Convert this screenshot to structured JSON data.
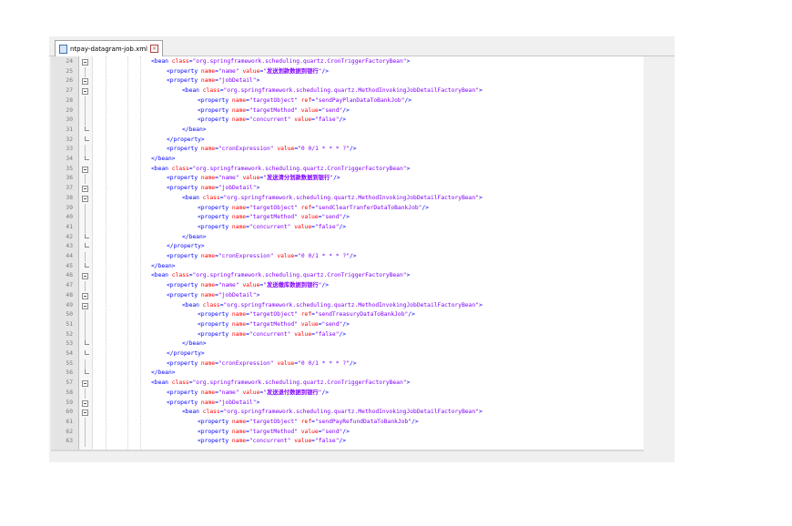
{
  "tab": {
    "label": "ntpay-datagram-job.xml",
    "close": "×"
  },
  "lines": [
    {
      "n": "24",
      "indent": 0,
      "fold": "box",
      "parts": [
        [
          "t",
          "<bean "
        ],
        [
          "a",
          "class"
        ],
        [
          "t",
          "="
        ],
        [
          "v",
          "\"org.springframework.scheduling.quartz.CronTriggerFactoryBean\""
        ],
        [
          "t",
          ">"
        ]
      ]
    },
    {
      "n": "25",
      "indent": 1,
      "fold": "vl",
      "parts": [
        [
          "t",
          "<property "
        ],
        [
          "a",
          "name"
        ],
        [
          "t",
          "="
        ],
        [
          "v",
          "\"name\" "
        ],
        [
          "a",
          "value"
        ],
        [
          "t",
          "="
        ],
        [
          "v",
          "\""
        ],
        [
          "cn",
          "发送划款数据到银行"
        ],
        [
          "v",
          "\""
        ],
        [
          "t",
          "/>"
        ]
      ]
    },
    {
      "n": "26",
      "indent": 1,
      "fold": "box",
      "parts": [
        [
          "t",
          "<property "
        ],
        [
          "a",
          "name"
        ],
        [
          "t",
          "="
        ],
        [
          "v",
          "\"jobDetail\""
        ],
        [
          "t",
          ">"
        ]
      ]
    },
    {
      "n": "27",
      "indent": 2,
      "fold": "box",
      "parts": [
        [
          "t",
          "<bean "
        ],
        [
          "a",
          "class"
        ],
        [
          "t",
          "="
        ],
        [
          "v",
          "\"org.springframework.scheduling.quartz.MethodInvokingJobDetailFactoryBean\""
        ],
        [
          "t",
          ">"
        ]
      ]
    },
    {
      "n": "28",
      "indent": 3,
      "fold": "vl",
      "parts": [
        [
          "t",
          "<property "
        ],
        [
          "a",
          "name"
        ],
        [
          "t",
          "="
        ],
        [
          "v",
          "\"targetObject\" "
        ],
        [
          "a",
          "ref"
        ],
        [
          "t",
          "="
        ],
        [
          "v",
          "\"sendPayPlanDataToBankJob\""
        ],
        [
          "t",
          "/>"
        ]
      ]
    },
    {
      "n": "29",
      "indent": 3,
      "fold": "vl",
      "parts": [
        [
          "t",
          "<property "
        ],
        [
          "a",
          "name"
        ],
        [
          "t",
          "="
        ],
        [
          "v",
          "\"targetMethod\" "
        ],
        [
          "a",
          "value"
        ],
        [
          "t",
          "="
        ],
        [
          "v",
          "\"send\""
        ],
        [
          "t",
          "/>"
        ]
      ]
    },
    {
      "n": "30",
      "indent": 3,
      "fold": "vl",
      "parts": [
        [
          "t",
          "<property "
        ],
        [
          "a",
          "name"
        ],
        [
          "t",
          "="
        ],
        [
          "v",
          "\"concurrent\" "
        ],
        [
          "a",
          "value"
        ],
        [
          "t",
          "="
        ],
        [
          "v",
          "\"false\""
        ],
        [
          "t",
          "/>"
        ]
      ]
    },
    {
      "n": "31",
      "indent": 2,
      "fold": "end",
      "parts": [
        [
          "t",
          "</bean>"
        ]
      ]
    },
    {
      "n": "32",
      "indent": 1,
      "fold": "end",
      "parts": [
        [
          "t",
          "</property>"
        ]
      ]
    },
    {
      "n": "33",
      "indent": 1,
      "fold": "vl",
      "parts": [
        [
          "t",
          "<property "
        ],
        [
          "a",
          "name"
        ],
        [
          "t",
          "="
        ],
        [
          "v",
          "\"cronExpression\" "
        ],
        [
          "a",
          "value"
        ],
        [
          "t",
          "="
        ],
        [
          "v",
          "\"0 0/1 * * * ?\""
        ],
        [
          "t",
          "/>"
        ]
      ]
    },
    {
      "n": "34",
      "indent": 0,
      "fold": "end",
      "parts": [
        [
          "t",
          "</bean>"
        ]
      ]
    },
    {
      "n": "35",
      "indent": 0,
      "fold": "box",
      "parts": [
        [
          "t",
          "<bean "
        ],
        [
          "a",
          "class"
        ],
        [
          "t",
          "="
        ],
        [
          "v",
          "\"org.springframework.scheduling.quartz.CronTriggerFactoryBean\""
        ],
        [
          "t",
          ">"
        ]
      ]
    },
    {
      "n": "36",
      "indent": 1,
      "fold": "vl",
      "parts": [
        [
          "t",
          "<property "
        ],
        [
          "a",
          "name"
        ],
        [
          "t",
          "="
        ],
        [
          "v",
          "\"name\" "
        ],
        [
          "a",
          "value"
        ],
        [
          "t",
          "="
        ],
        [
          "v",
          "\""
        ],
        [
          "cn",
          "发送清分划款数据到银行"
        ],
        [
          "v",
          "\""
        ],
        [
          "t",
          "/>"
        ]
      ]
    },
    {
      "n": "37",
      "indent": 1,
      "fold": "box",
      "parts": [
        [
          "t",
          "<property "
        ],
        [
          "a",
          "name"
        ],
        [
          "t",
          "="
        ],
        [
          "v",
          "\"jobDetail\""
        ],
        [
          "t",
          ">"
        ]
      ]
    },
    {
      "n": "38",
      "indent": 2,
      "fold": "box",
      "parts": [
        [
          "t",
          "<bean "
        ],
        [
          "a",
          "class"
        ],
        [
          "t",
          "="
        ],
        [
          "v",
          "\"org.springframework.scheduling.quartz.MethodInvokingJobDetailFactoryBean\""
        ],
        [
          "t",
          ">"
        ]
      ]
    },
    {
      "n": "39",
      "indent": 3,
      "fold": "vl",
      "parts": [
        [
          "t",
          "<property "
        ],
        [
          "a",
          "name"
        ],
        [
          "t",
          "="
        ],
        [
          "v",
          "\"targetObject\" "
        ],
        [
          "a",
          "ref"
        ],
        [
          "t",
          "="
        ],
        [
          "v",
          "\"sendClearTranferDataToBankJob\""
        ],
        [
          "t",
          "/>"
        ]
      ]
    },
    {
      "n": "40",
      "indent": 3,
      "fold": "vl",
      "parts": [
        [
          "t",
          "<property "
        ],
        [
          "a",
          "name"
        ],
        [
          "t",
          "="
        ],
        [
          "v",
          "\"targetMethod\" "
        ],
        [
          "a",
          "value"
        ],
        [
          "t",
          "="
        ],
        [
          "v",
          "\"send\""
        ],
        [
          "t",
          "/>"
        ]
      ]
    },
    {
      "n": "41",
      "indent": 3,
      "fold": "vl",
      "parts": [
        [
          "t",
          "<property "
        ],
        [
          "a",
          "name"
        ],
        [
          "t",
          "="
        ],
        [
          "v",
          "\"concurrent\" "
        ],
        [
          "a",
          "value"
        ],
        [
          "t",
          "="
        ],
        [
          "v",
          "\"false\""
        ],
        [
          "t",
          "/>"
        ]
      ]
    },
    {
      "n": "42",
      "indent": 2,
      "fold": "end",
      "parts": [
        [
          "t",
          "</bean>"
        ]
      ]
    },
    {
      "n": "43",
      "indent": 1,
      "fold": "end",
      "parts": [
        [
          "t",
          "</property>"
        ]
      ]
    },
    {
      "n": "44",
      "indent": 1,
      "fold": "vl",
      "parts": [
        [
          "t",
          "<property "
        ],
        [
          "a",
          "name"
        ],
        [
          "t",
          "="
        ],
        [
          "v",
          "\"cronExpression\" "
        ],
        [
          "a",
          "value"
        ],
        [
          "t",
          "="
        ],
        [
          "v",
          "\"0 0/1 * * * ?\""
        ],
        [
          "t",
          "/>"
        ]
      ]
    },
    {
      "n": "45",
      "indent": 0,
      "fold": "end",
      "parts": [
        [
          "t",
          "</bean>"
        ]
      ]
    },
    {
      "n": "46",
      "indent": 0,
      "fold": "box",
      "parts": [
        [
          "t",
          "<bean "
        ],
        [
          "a",
          "class"
        ],
        [
          "t",
          "="
        ],
        [
          "v",
          "\"org.springframework.scheduling.quartz.CronTriggerFactoryBean\""
        ],
        [
          "t",
          ">"
        ]
      ]
    },
    {
      "n": "47",
      "indent": 1,
      "fold": "vl",
      "parts": [
        [
          "t",
          "<property "
        ],
        [
          "a",
          "name"
        ],
        [
          "t",
          "="
        ],
        [
          "v",
          "\"name\" "
        ],
        [
          "a",
          "value"
        ],
        [
          "t",
          "="
        ],
        [
          "v",
          "\""
        ],
        [
          "cn",
          "发送缴库数据到银行"
        ],
        [
          "v",
          "\""
        ],
        [
          "t",
          "/>"
        ]
      ]
    },
    {
      "n": "48",
      "indent": 1,
      "fold": "box",
      "parts": [
        [
          "t",
          "<property "
        ],
        [
          "a",
          "name"
        ],
        [
          "t",
          "="
        ],
        [
          "v",
          "\"jobDetail\""
        ],
        [
          "t",
          ">"
        ]
      ]
    },
    {
      "n": "49",
      "indent": 2,
      "fold": "box",
      "parts": [
        [
          "t",
          "<bean "
        ],
        [
          "a",
          "class"
        ],
        [
          "t",
          "="
        ],
        [
          "v",
          "\"org.springframework.scheduling.quartz.MethodInvokingJobDetailFactoryBean\""
        ],
        [
          "t",
          ">"
        ]
      ]
    },
    {
      "n": "50",
      "indent": 3,
      "fold": "vl",
      "parts": [
        [
          "t",
          "<property "
        ],
        [
          "a",
          "name"
        ],
        [
          "t",
          "="
        ],
        [
          "v",
          "\"targetObject\" "
        ],
        [
          "a",
          "ref"
        ],
        [
          "t",
          "="
        ],
        [
          "v",
          "\"sendTreasuryDataToBankJob\""
        ],
        [
          "t",
          "/>"
        ]
      ]
    },
    {
      "n": "51",
      "indent": 3,
      "fold": "vl",
      "parts": [
        [
          "t",
          "<property "
        ],
        [
          "a",
          "name"
        ],
        [
          "t",
          "="
        ],
        [
          "v",
          "\"targetMethod\" "
        ],
        [
          "a",
          "value"
        ],
        [
          "t",
          "="
        ],
        [
          "v",
          "\"send\""
        ],
        [
          "t",
          "/>"
        ]
      ]
    },
    {
      "n": "52",
      "indent": 3,
      "fold": "vl",
      "parts": [
        [
          "t",
          "<property "
        ],
        [
          "a",
          "name"
        ],
        [
          "t",
          "="
        ],
        [
          "v",
          "\"concurrent\" "
        ],
        [
          "a",
          "value"
        ],
        [
          "t",
          "="
        ],
        [
          "v",
          "\"false\""
        ],
        [
          "t",
          "/>"
        ]
      ]
    },
    {
      "n": "53",
      "indent": 2,
      "fold": "end",
      "parts": [
        [
          "t",
          "</bean>"
        ]
      ]
    },
    {
      "n": "54",
      "indent": 1,
      "fold": "end",
      "parts": [
        [
          "t",
          "</property>"
        ]
      ]
    },
    {
      "n": "55",
      "indent": 1,
      "fold": "vl",
      "parts": [
        [
          "t",
          "<property "
        ],
        [
          "a",
          "name"
        ],
        [
          "t",
          "="
        ],
        [
          "v",
          "\"cronExpression\" "
        ],
        [
          "a",
          "value"
        ],
        [
          "t",
          "="
        ],
        [
          "v",
          "\"0 0/1 * * * ?\""
        ],
        [
          "t",
          "/>"
        ]
      ]
    },
    {
      "n": "56",
      "indent": 0,
      "fold": "end",
      "parts": [
        [
          "t",
          "</bean>"
        ]
      ]
    },
    {
      "n": "57",
      "indent": 0,
      "fold": "box",
      "parts": [
        [
          "t",
          "<bean "
        ],
        [
          "a",
          "class"
        ],
        [
          "t",
          "="
        ],
        [
          "v",
          "\"org.springframework.scheduling.quartz.CronTriggerFactoryBean\""
        ],
        [
          "t",
          ">"
        ]
      ]
    },
    {
      "n": "58",
      "indent": 1,
      "fold": "vl",
      "parts": [
        [
          "t",
          "<property "
        ],
        [
          "a",
          "name"
        ],
        [
          "t",
          "="
        ],
        [
          "v",
          "\"name\" "
        ],
        [
          "a",
          "value"
        ],
        [
          "t",
          "="
        ],
        [
          "v",
          "\""
        ],
        [
          "cn",
          "发送退付数据到银行"
        ],
        [
          "v",
          "\""
        ],
        [
          "t",
          "/>"
        ]
      ]
    },
    {
      "n": "59",
      "indent": 1,
      "fold": "box",
      "parts": [
        [
          "t",
          "<property "
        ],
        [
          "a",
          "name"
        ],
        [
          "t",
          "="
        ],
        [
          "v",
          "\"jobDetail\""
        ],
        [
          "t",
          ">"
        ]
      ]
    },
    {
      "n": "60",
      "indent": 2,
      "fold": "box",
      "parts": [
        [
          "t",
          "<bean "
        ],
        [
          "a",
          "class"
        ],
        [
          "t",
          "="
        ],
        [
          "v",
          "\"org.springframework.scheduling.quartz.MethodInvokingJobDetailFactoryBean\""
        ],
        [
          "t",
          ">"
        ]
      ]
    },
    {
      "n": "61",
      "indent": 3,
      "fold": "vl",
      "parts": [
        [
          "t",
          "<property "
        ],
        [
          "a",
          "name"
        ],
        [
          "t",
          "="
        ],
        [
          "v",
          "\"targetObject\" "
        ],
        [
          "a",
          "ref"
        ],
        [
          "t",
          "="
        ],
        [
          "v",
          "\"sendPayRefundDataToBankJob\""
        ],
        [
          "t",
          "/>"
        ]
      ]
    },
    {
      "n": "62",
      "indent": 3,
      "fold": "vl",
      "parts": [
        [
          "t",
          "<property "
        ],
        [
          "a",
          "name"
        ],
        [
          "t",
          "="
        ],
        [
          "v",
          "\"targetMethod\" "
        ],
        [
          "a",
          "value"
        ],
        [
          "t",
          "="
        ],
        [
          "v",
          "\"send\""
        ],
        [
          "t",
          "/>"
        ]
      ]
    },
    {
      "n": "63",
      "indent": 3,
      "fold": "vl",
      "parts": [
        [
          "t",
          "<property "
        ],
        [
          "a",
          "name"
        ],
        [
          "t",
          "="
        ],
        [
          "v",
          "\"concurrent\" "
        ],
        [
          "a",
          "value"
        ],
        [
          "t",
          "="
        ],
        [
          "v",
          "\"false\""
        ],
        [
          "t",
          "/>"
        ]
      ]
    }
  ]
}
